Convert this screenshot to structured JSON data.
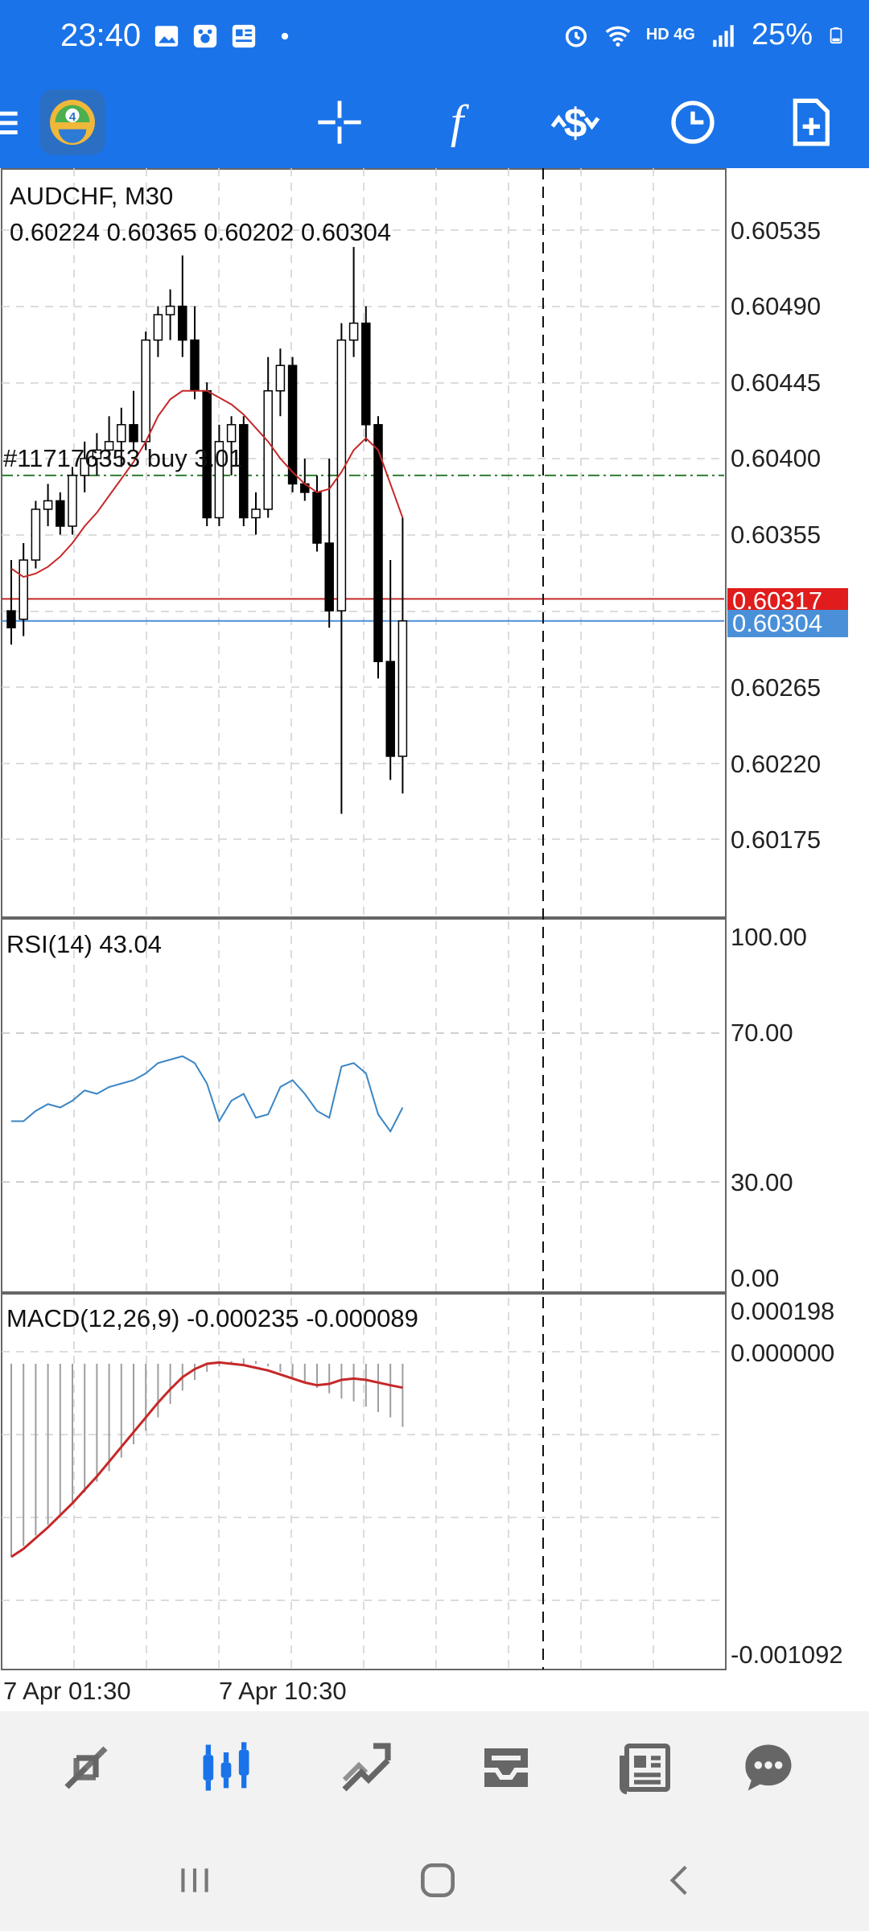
{
  "status_bar": {
    "time": "23:40",
    "network": "HD 4G",
    "battery": "25%",
    "icons": [
      "image-icon",
      "paw-icon",
      "news-icon",
      "dot-icon",
      "alarm-icon",
      "wifi-icon",
      "signal-icon",
      "battery-icon"
    ]
  },
  "toolbar": {
    "app_logo": "metatrader-logo-icon",
    "buttons": [
      "menu-icon",
      "crosshair-icon",
      "indicator-icon",
      "trade-icon",
      "period-icon",
      "new-order-icon"
    ]
  },
  "chart": {
    "symbol_line": "AUDCHF, M30",
    "ohlc_line": "0.60224 0.60365 0.60202 0.60304",
    "order_label": "#117176353 buy 3.01",
    "price_axis": [
      "0.60535",
      "0.60490",
      "0.60445",
      "0.60400",
      "0.60355",
      "0.60265",
      "0.60220",
      "0.60175"
    ],
    "ask_tag": "0.60317",
    "bid_tag": "0.60304",
    "rsi_label": "RSI(14) 43.04",
    "rsi_axis": [
      "100.00",
      "70.00",
      "30.00",
      "0.00"
    ],
    "macd_label": "MACD(12,26,9) -0.000235 -0.000089",
    "macd_axis": [
      "0.000198",
      "0.000000",
      "-0.001092"
    ],
    "time_axis": [
      "7 Apr 01:30",
      "7 Apr 10:30"
    ],
    "colors": {
      "ask_line": "#c62828",
      "bid_line": "#4a90d9",
      "ma_line": "#c62828",
      "rsi_line": "#3a86c5",
      "macd_signal": "#c62828",
      "order_line": "#2e7d32"
    }
  },
  "chart_data": {
    "type": "candlestick",
    "symbol": "AUDCHF",
    "timeframe": "M30",
    "price_range": [
      0.6013,
      0.6056
    ],
    "candles": [
      {
        "o": 0.6031,
        "h": 0.6034,
        "l": 0.6029,
        "c": 0.603
      },
      {
        "o": 0.60305,
        "h": 0.6035,
        "l": 0.60295,
        "c": 0.6034
      },
      {
        "o": 0.6034,
        "h": 0.60375,
        "l": 0.60335,
        "c": 0.6037
      },
      {
        "o": 0.6037,
        "h": 0.60385,
        "l": 0.6036,
        "c": 0.60375
      },
      {
        "o": 0.60375,
        "h": 0.6038,
        "l": 0.60355,
        "c": 0.6036
      },
      {
        "o": 0.6036,
        "h": 0.60395,
        "l": 0.60355,
        "c": 0.6039
      },
      {
        "o": 0.6039,
        "h": 0.6041,
        "l": 0.6038,
        "c": 0.604
      },
      {
        "o": 0.604,
        "h": 0.60415,
        "l": 0.6039,
        "c": 0.60405
      },
      {
        "o": 0.60405,
        "h": 0.60425,
        "l": 0.604,
        "c": 0.6041
      },
      {
        "o": 0.6041,
        "h": 0.6043,
        "l": 0.60395,
        "c": 0.6042
      },
      {
        "o": 0.6042,
        "h": 0.6044,
        "l": 0.60405,
        "c": 0.6041
      },
      {
        "o": 0.6041,
        "h": 0.60475,
        "l": 0.60405,
        "c": 0.6047
      },
      {
        "o": 0.6047,
        "h": 0.6049,
        "l": 0.6046,
        "c": 0.60485
      },
      {
        "o": 0.60485,
        "h": 0.605,
        "l": 0.6047,
        "c": 0.6049
      },
      {
        "o": 0.6049,
        "h": 0.6052,
        "l": 0.6046,
        "c": 0.6047
      },
      {
        "o": 0.6047,
        "h": 0.6049,
        "l": 0.60435,
        "c": 0.6044
      },
      {
        "o": 0.6044,
        "h": 0.60445,
        "l": 0.6036,
        "c": 0.60365
      },
      {
        "o": 0.60365,
        "h": 0.6042,
        "l": 0.6036,
        "c": 0.6041
      },
      {
        "o": 0.6041,
        "h": 0.60425,
        "l": 0.6039,
        "c": 0.6042
      },
      {
        "o": 0.6042,
        "h": 0.60425,
        "l": 0.6036,
        "c": 0.60365
      },
      {
        "o": 0.60365,
        "h": 0.6038,
        "l": 0.60355,
        "c": 0.6037
      },
      {
        "o": 0.6037,
        "h": 0.6046,
        "l": 0.60365,
        "c": 0.6044
      },
      {
        "o": 0.6044,
        "h": 0.60465,
        "l": 0.60425,
        "c": 0.60455
      },
      {
        "o": 0.60455,
        "h": 0.6046,
        "l": 0.6038,
        "c": 0.60385
      },
      {
        "o": 0.60385,
        "h": 0.604,
        "l": 0.60375,
        "c": 0.6038
      },
      {
        "o": 0.6038,
        "h": 0.6039,
        "l": 0.60345,
        "c": 0.6035
      },
      {
        "o": 0.6035,
        "h": 0.604,
        "l": 0.603,
        "c": 0.6031
      },
      {
        "o": 0.6031,
        "h": 0.6048,
        "l": 0.6019,
        "c": 0.6047
      },
      {
        "o": 0.6047,
        "h": 0.60525,
        "l": 0.6046,
        "c": 0.6048
      },
      {
        "o": 0.6048,
        "h": 0.6049,
        "l": 0.6041,
        "c": 0.6042
      },
      {
        "o": 0.6042,
        "h": 0.60425,
        "l": 0.6027,
        "c": 0.6028
      },
      {
        "o": 0.6028,
        "h": 0.6034,
        "l": 0.6021,
        "c": 0.60224
      },
      {
        "o": 0.60224,
        "h": 0.60365,
        "l": 0.60202,
        "c": 0.60304
      }
    ],
    "moving_average": [
      0.60335,
      0.6033,
      0.60332,
      0.60336,
      0.60342,
      0.6035,
      0.6036,
      0.60368,
      0.60378,
      0.60388,
      0.60398,
      0.6041,
      0.60425,
      0.60435,
      0.6044,
      0.6044,
      0.6044,
      0.60436,
      0.60432,
      0.60426,
      0.60418,
      0.6041,
      0.604,
      0.60392,
      0.60385,
      0.6038,
      0.60382,
      0.60392,
      0.60405,
      0.60412,
      0.60405,
      0.60385,
      0.60365
    ],
    "rsi": [
      46,
      46,
      49,
      51,
      50,
      52,
      55,
      54,
      56,
      57,
      58,
      60,
      63,
      64,
      65,
      63,
      57,
      46,
      52,
      54,
      47,
      48,
      56,
      58,
      54,
      49,
      47,
      62,
      63,
      60,
      48,
      43,
      50
    ],
    "macd_hist": [
      -0.00072,
      -0.00068,
      -0.00064,
      -0.0006,
      -0.00056,
      -0.00052,
      -0.00048,
      -0.00044,
      -0.0004,
      -0.00035,
      -0.0003,
      -0.00025,
      -0.0002,
      -0.00015,
      -0.0001,
      -6e-05,
      -3e-05,
      -1e-05,
      1e-05,
      2e-05,
      1e-05,
      -1e-05,
      -3e-05,
      -5e-05,
      -7e-05,
      -9e-05,
      -0.00011,
      -0.00013,
      -0.00014,
      -0.00016,
      -0.00018,
      -0.0002,
      -0.000235
    ],
    "macd_signal": [
      -0.00072,
      -0.00069,
      -0.00065,
      -0.00061,
      -0.000565,
      -0.00052,
      -0.00047,
      -0.00042,
      -0.000365,
      -0.00031,
      -0.000255,
      -0.0002,
      -0.000145,
      -9.5e-05,
      -5e-05,
      -2e-05,
      0.0,
      5e-06,
      0.0,
      -5e-06,
      -1.5e-05,
      -2.5e-05,
      -4e-05,
      -5.5e-05,
      -7e-05,
      -8e-05,
      -7.5e-05,
      -6e-05,
      -5.5e-05,
      -6e-05,
      -7e-05,
      -8e-05,
      -8.9e-05
    ],
    "ask": 0.60317,
    "bid": 0.60304,
    "order_price": 0.6039
  },
  "bottom_nav": {
    "items": [
      "quotes-icon",
      "chart-icon",
      "trade-icon",
      "history-icon",
      "news-icon",
      "messages-icon"
    ]
  }
}
